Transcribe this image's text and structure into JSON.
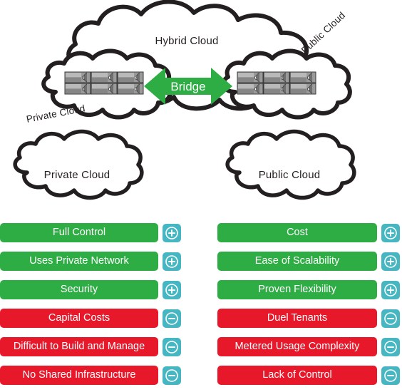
{
  "diagram": {
    "hybrid_cloud_label": "Hybrid Cloud",
    "bridge_label": "Bridge",
    "inner_private_label": "Private Cloud",
    "inner_public_label": "Public Cloud",
    "standalone_private_label": "Private Cloud",
    "standalone_public_label": "Public Cloud",
    "server_icon_name": "server-rack-icon",
    "server_count_per_cloud": 6
  },
  "colors": {
    "pro": "#2fad45",
    "con": "#e8182b",
    "toggle": "#45b6c2",
    "text_on_bar": "#ffffff",
    "outline": "#231f20"
  },
  "columns": [
    {
      "id": "private-cloud",
      "items": [
        {
          "label": "Full Control",
          "kind": "pro",
          "icon": "plus-icon"
        },
        {
          "label": "Uses Private Network",
          "kind": "pro",
          "icon": "plus-icon"
        },
        {
          "label": "Security",
          "kind": "pro",
          "icon": "plus-icon"
        },
        {
          "label": "Capital Costs",
          "kind": "con",
          "icon": "minus-icon"
        },
        {
          "label": "Difficult to Build and Manage",
          "kind": "con",
          "icon": "minus-icon"
        },
        {
          "label": "No Shared Infrastructure",
          "kind": "con",
          "icon": "minus-icon"
        }
      ]
    },
    {
      "id": "public-cloud",
      "items": [
        {
          "label": "Cost",
          "kind": "pro",
          "icon": "plus-icon"
        },
        {
          "label": "Ease of Scalability",
          "kind": "pro",
          "icon": "plus-icon"
        },
        {
          "label": "Proven Flexibility",
          "kind": "pro",
          "icon": "plus-icon"
        },
        {
          "label": "Duel Tenants",
          "kind": "con",
          "icon": "minus-icon"
        },
        {
          "label": "Metered Usage Complexity",
          "kind": "con",
          "icon": "minus-icon"
        },
        {
          "label": "Lack of Control",
          "kind": "con",
          "icon": "minus-icon"
        }
      ]
    }
  ]
}
